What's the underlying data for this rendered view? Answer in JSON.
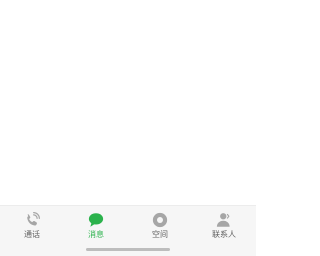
{
  "colors": {
    "tabbar_bg": "#f6f6f6",
    "icon_inactive": "#a6a6a6",
    "label_inactive": "#5f5f5f",
    "accent_green": "#2bb24c",
    "home_indicator": "#bdbdbd"
  },
  "tabbar": {
    "tabs": [
      {
        "label": "通话",
        "icon": "phone-icon",
        "active": false
      },
      {
        "label": "消息",
        "icon": "chat-bubble-icon",
        "active": true
      },
      {
        "label": "空间",
        "icon": "space-circle-icon",
        "active": false
      },
      {
        "label": "联系人",
        "icon": "contacts-person-icon",
        "active": false
      }
    ]
  }
}
